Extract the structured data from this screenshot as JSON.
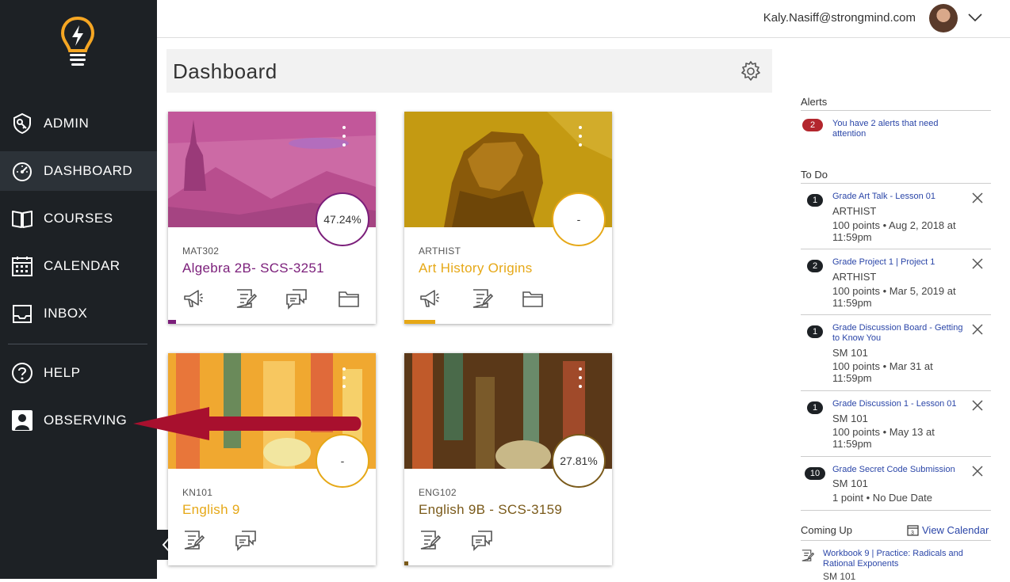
{
  "user": {
    "email": "Kaly.Nasiff@strongmind.com"
  },
  "nav": {
    "admin": "ADMIN",
    "dashboard": "DASHBOARD",
    "courses": "COURSES",
    "calendar": "CALENDAR",
    "inbox": "INBOX",
    "help": "HELP",
    "observing": "OBSERVING"
  },
  "dashboard": {
    "title": "Dashboard"
  },
  "courses": [
    {
      "code": "MAT302",
      "name": "Algebra 2B- SCS-3251",
      "grade": "47.24%",
      "color": "#7b1e7a",
      "progress": 0.04
    },
    {
      "code": "ARTHIST",
      "name": "Art History Origins",
      "grade": "-",
      "color": "#e6a817",
      "progress": 0.15
    },
    {
      "code": "KN101",
      "name": "English 9",
      "grade": "-",
      "color": "#e6a817",
      "progress": 0
    },
    {
      "code": "ENG102",
      "name": "English 9B - SCS-3159",
      "grade": "27.81%",
      "color": "#7a5a1a",
      "progress": 0.02
    }
  ],
  "alerts": {
    "title": "Alerts",
    "count": "2",
    "message": "You have 2 alerts that need attention"
  },
  "todo": {
    "title": "To Do",
    "items": [
      {
        "num": "1",
        "title": "Grade Art Talk - Lesson 01",
        "course": "ARTHIST",
        "meta": "100 points • Aug 2, 2018 at 11:59pm"
      },
      {
        "num": "2",
        "title": "Grade Project 1 | Project 1",
        "course": "ARTHIST",
        "meta": "100 points • Mar 5, 2019 at 11:59pm"
      },
      {
        "num": "1",
        "title": "Grade Discussion Board - Getting to Know You",
        "course": "SM 101",
        "meta": "100 points • Mar 31 at 11:59pm"
      },
      {
        "num": "1",
        "title": "Grade Discussion 1 - Lesson 01",
        "course": "SM 101",
        "meta": "100 points • May 13 at 11:59pm"
      },
      {
        "num": "10",
        "title": "Grade Secret Code Submission",
        "course": "SM 101",
        "meta": "1 point • No Due Date"
      }
    ]
  },
  "coming_up": {
    "title": "Coming Up",
    "view_calendar": "View Calendar",
    "calendar_day": "3",
    "item_title": "Workbook 9 | Practice: Radicals and Rational Exponents",
    "item_course": "SM 101"
  }
}
